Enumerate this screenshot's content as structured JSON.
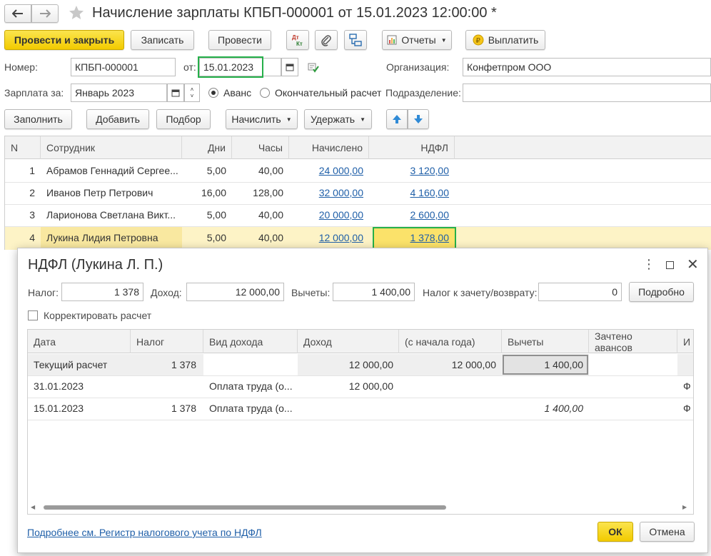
{
  "window": {
    "title": "Начисление зарплаты КПБП-000001 от 15.01.2023 12:00:00 *"
  },
  "toolbar": {
    "post_close": "Провести и закрыть",
    "save": "Записать",
    "post": "Провести",
    "reports": "Отчеты",
    "pay": "Выплатить"
  },
  "form": {
    "number_label": "Номер:",
    "number_value": "КПБП-000001",
    "date_label": "от:",
    "date_value": "15.01.2023",
    "org_label": "Организация:",
    "org_value": "Конфетпром ООО",
    "salary_for_label": "Зарплата за:",
    "salary_for_value": "Январь 2023",
    "radio_advance": "Аванс",
    "radio_final": "Окончательный расчет",
    "radio_selected": "advance",
    "division_label": "Подразделение:",
    "division_value": ""
  },
  "table_toolbar": {
    "fill": "Заполнить",
    "add": "Добавить",
    "pick": "Подбор",
    "accrue": "Начислить",
    "deduct": "Удержать"
  },
  "table": {
    "columns": [
      "N",
      "Сотрудник",
      "Дни",
      "Часы",
      "Начислено",
      "НДФЛ"
    ],
    "rows": [
      {
        "n": "1",
        "employee": "Абрамов Геннадий Сергее...",
        "days": "5,00",
        "hours": "40,00",
        "accrued": "24 000,00",
        "ndfl": "3 120,00"
      },
      {
        "n": "2",
        "employee": "Иванов Петр Петрович",
        "days": "16,00",
        "hours": "128,00",
        "accrued": "32 000,00",
        "ndfl": "4 160,00"
      },
      {
        "n": "3",
        "employee": "Ларионова Светлана Викт...",
        "days": "5,00",
        "hours": "40,00",
        "accrued": "20 000,00",
        "ndfl": "2 600,00"
      },
      {
        "n": "4",
        "employee": "Лукина Лидия Петровна",
        "days": "5,00",
        "hours": "40,00",
        "accrued": "12 000,00",
        "ndfl": "1 378,00"
      }
    ],
    "selected_row": 3
  },
  "dialog": {
    "title": "НДФЛ (Лукина Л. П.)",
    "tax_label": "Налог:",
    "tax_value": "1 378",
    "income_label": "Доход:",
    "income_value": "12 000,00",
    "deductions_label": "Вычеты:",
    "deductions_value": "1 400,00",
    "refund_label": "Налог к зачету/возврату:",
    "refund_value": "0",
    "details_button": "Подробно",
    "correct_checkbox": "Корректировать расчет",
    "grid": {
      "columns": [
        "Дата",
        "Налог",
        "Вид дохода",
        "Доход",
        "(с начала года)",
        "Вычеты",
        "Зачтено авансов",
        "И"
      ],
      "rows": [
        {
          "date": "Текущий расчет",
          "tax": "1 378",
          "kind": "",
          "income": "12 000,00",
          "ytd": "12 000,00",
          "deductions": "1 400,00",
          "advances": "",
          "extra": ""
        },
        {
          "date": "31.01.2023",
          "tax": "",
          "kind": "Оплата труда (о...",
          "income": "12 000,00",
          "ytd": "",
          "deductions": "",
          "advances": "",
          "extra": "Ф"
        },
        {
          "date": "15.01.2023",
          "tax": "1 378",
          "kind": "Оплата труда (о...",
          "income": "",
          "ytd": "",
          "deductions": "1 400,00",
          "advances": "",
          "extra": "Ф"
        }
      ]
    },
    "footer_link": "Подробнее см. Регистр налогового учета по НДФЛ",
    "ok": "ОК",
    "cancel": "Отмена"
  },
  "colors": {
    "accent_yellow": "#f2cb00",
    "highlight_row": "#fdf3c6",
    "green_frame": "#25b04a",
    "link": "#1f5fa8"
  }
}
